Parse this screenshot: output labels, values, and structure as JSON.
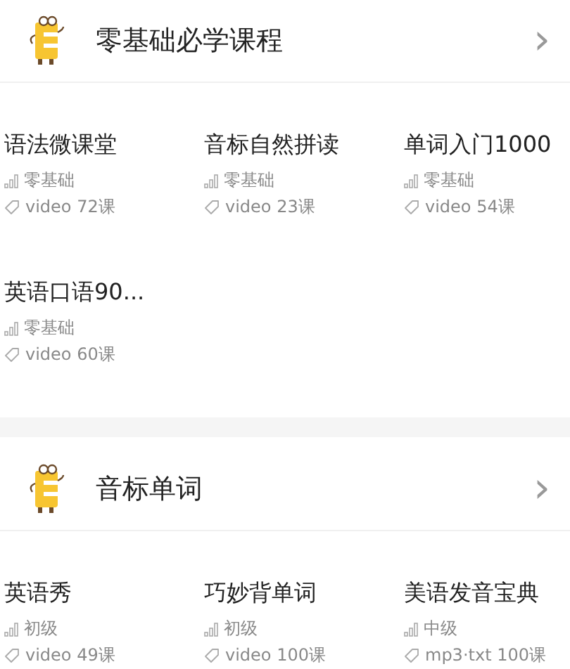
{
  "sections": [
    {
      "title": "零基础必学课程",
      "arrow": "›",
      "courses": [
        {
          "title": "语法微课堂",
          "level": "零基础",
          "tag": "video 72课"
        },
        {
          "title": "音标自然拼读",
          "level": "零基础",
          "tag": "video 23课"
        },
        {
          "title": "单词入门1000",
          "level": "零基础",
          "tag": "video 54课"
        },
        {
          "title": "英语口语90...",
          "level": "零基础",
          "tag": "video 60课"
        }
      ]
    },
    {
      "title": "音标单词",
      "arrow": "›",
      "courses": [
        {
          "title": "英语秀",
          "level": "初级",
          "tag": "video 49课"
        },
        {
          "title": "巧妙背单词",
          "level": "初级",
          "tag": "video 100课"
        },
        {
          "title": "美语发音宝典",
          "level": "中级",
          "tag": "mp3·txt 100课"
        }
      ]
    }
  ]
}
